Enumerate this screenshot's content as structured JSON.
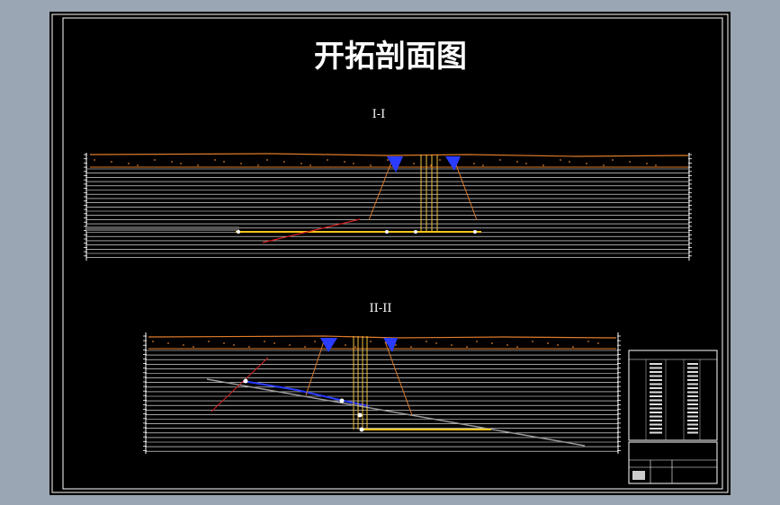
{
  "drawing": {
    "title": "开拓剖面图",
    "colors": {
      "background": "#000000",
      "frame": "#ffffff",
      "workspace": "#9aa6b3",
      "surface_line": "#e07b2a",
      "strata_line": "#ffffff",
      "shaft_line": "#f0c040",
      "roadway_yellow": "#f5c518",
      "seam_red": "#d62020",
      "seam_blue": "#2a3cff",
      "fault_gray": "#9a9a9a"
    }
  },
  "sections": [
    {
      "id": "section-1",
      "label": "I-I"
    },
    {
      "id": "section-2",
      "label": "II-II"
    }
  ]
}
